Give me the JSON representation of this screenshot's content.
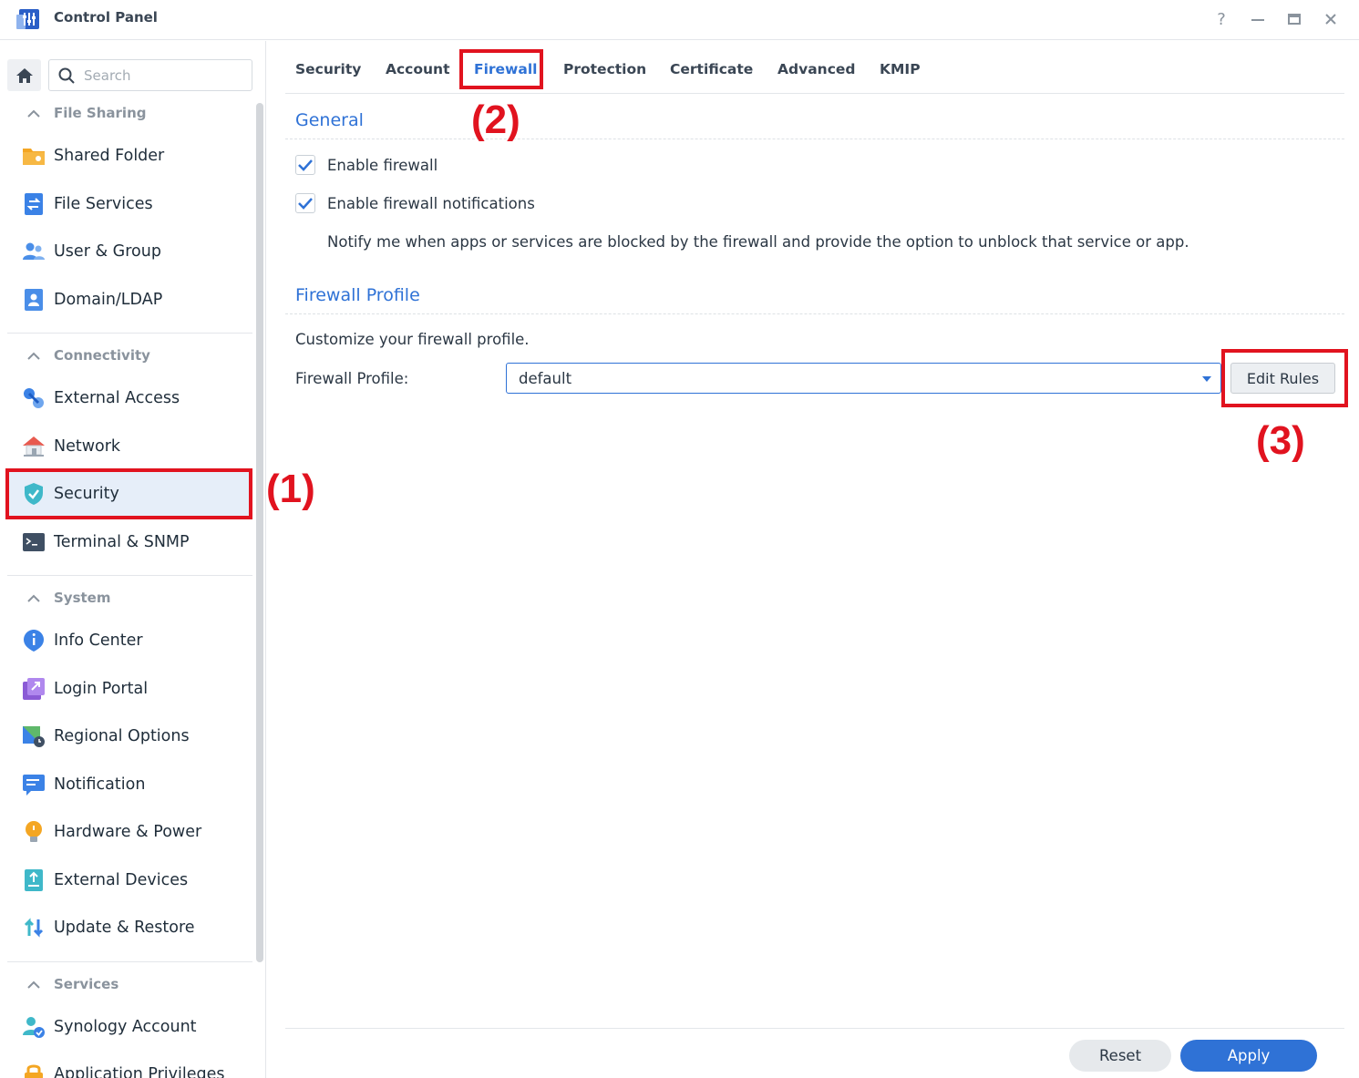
{
  "window": {
    "title": "Control Panel",
    "controls": {
      "help": "?",
      "minimize": "—",
      "maximize": "▭",
      "close": "✕"
    }
  },
  "sidebar": {
    "search_placeholder": "Search",
    "sections": [
      {
        "title": "File Sharing",
        "items": [
          "Shared Folder",
          "File Services",
          "User & Group",
          "Domain/LDAP"
        ]
      },
      {
        "title": "Connectivity",
        "items": [
          "External Access",
          "Network",
          "Security",
          "Terminal & SNMP"
        ]
      },
      {
        "title": "System",
        "items": [
          "Info Center",
          "Login Portal",
          "Regional Options",
          "Notification",
          "Hardware & Power",
          "External Devices",
          "Update & Restore"
        ]
      },
      {
        "title": "Services",
        "items": [
          "Synology Account",
          "Application Privileges"
        ]
      }
    ],
    "active_item": "Security"
  },
  "tabs": [
    "Security",
    "Account",
    "Firewall",
    "Protection",
    "Certificate",
    "Advanced",
    "KMIP"
  ],
  "active_tab": "Firewall",
  "general": {
    "title": "General",
    "enable_firewall": "Enable firewall",
    "enable_notifications": "Enable firewall notifications",
    "notify_desc": "Notify me when apps or services are blocked by the firewall and provide the option to unblock that service or app."
  },
  "profile": {
    "title": "Firewall Profile",
    "desc": "Customize your firewall profile.",
    "label": "Firewall Profile:",
    "value": "default",
    "edit_button": "Edit Rules"
  },
  "footer": {
    "reset": "Reset",
    "apply": "Apply"
  },
  "annotations": [
    "(1)",
    "(2)",
    "(3)"
  ],
  "colors": {
    "accent": "#2f72d6",
    "highlight": "#e1131f",
    "active_bg": "#e6eef9"
  }
}
